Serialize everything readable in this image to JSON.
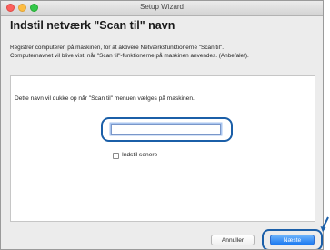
{
  "window": {
    "title": "Setup Wizard"
  },
  "page": {
    "heading": "Indstil netværk \"Scan til\" navn",
    "description_line1": "Registrer computeren på maskinen, for at aktivere Netværksfunktionerne \"Scan til\".",
    "description_line2": "Computernavnet vil blive vist, når \"Scan til\"-funktionerne på maskinen anvendes. (Anbefalet)."
  },
  "panel": {
    "label": "Dette navn vil dukke op når \"Scan til\" menuen vælges på maskinen.",
    "name_input": {
      "value": "",
      "placeholder": ""
    },
    "later_checkbox": {
      "label": "Indstil senere",
      "checked": false
    }
  },
  "buttons": {
    "cancel_label": "Annuller",
    "next_label": "Næste"
  },
  "colors": {
    "accent": "#1b79f1",
    "highlight": "#1b5fa8"
  }
}
